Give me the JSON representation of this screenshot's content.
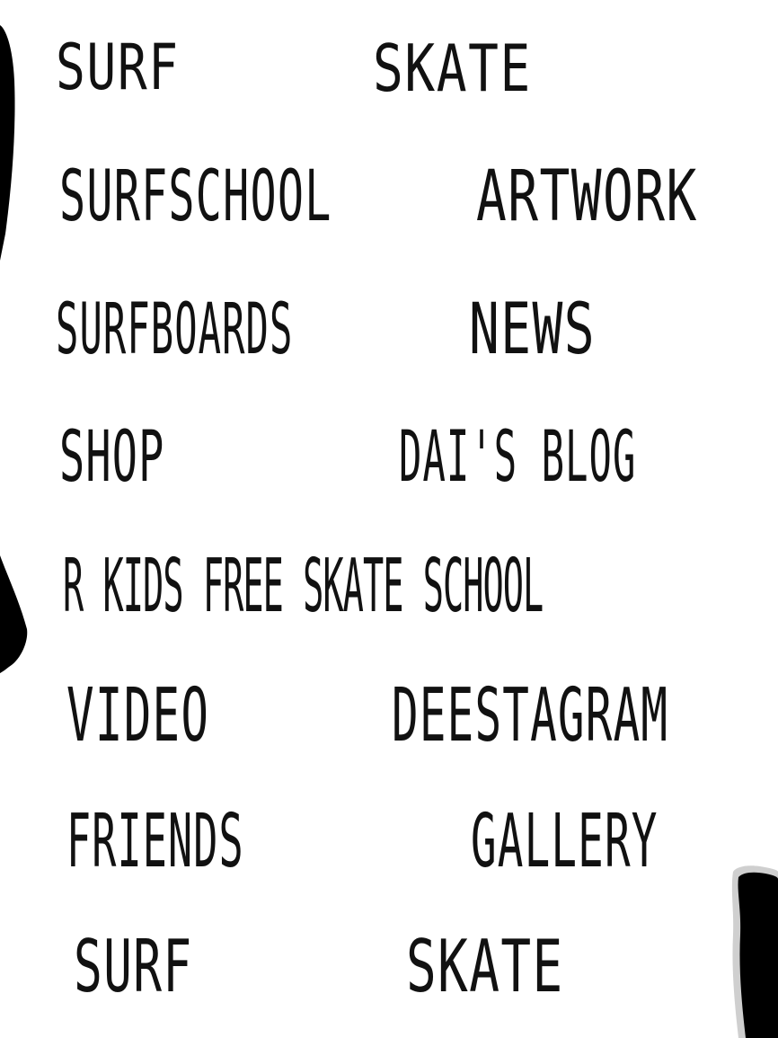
{
  "menu": {
    "row1": {
      "left": "SURF",
      "right": "SKATE"
    },
    "row2": {
      "left": "SURFSCHOOL",
      "right": "ARTWORK"
    },
    "row3": {
      "left": "SURFBOARDS",
      "right": "NEWS"
    },
    "row4": {
      "left": "SHOP",
      "right": "DAI'S BLOG"
    },
    "row5": {
      "full": "R KIDS FREE SKATE SCHOOL"
    },
    "row6": {
      "left": "VIDEO",
      "right": "DEESTAGRAM"
    },
    "row7": {
      "left": "FRIENDS",
      "right": "GALLERY"
    },
    "row8": {
      "left": "SURF",
      "right": "SKATE"
    }
  },
  "colors": {
    "background": "#ffffff",
    "text": "#111111",
    "ink": "#000000"
  },
  "icons": {
    "left_brush": "brush-stroke-left",
    "right_brush": "brush-stroke-right"
  }
}
